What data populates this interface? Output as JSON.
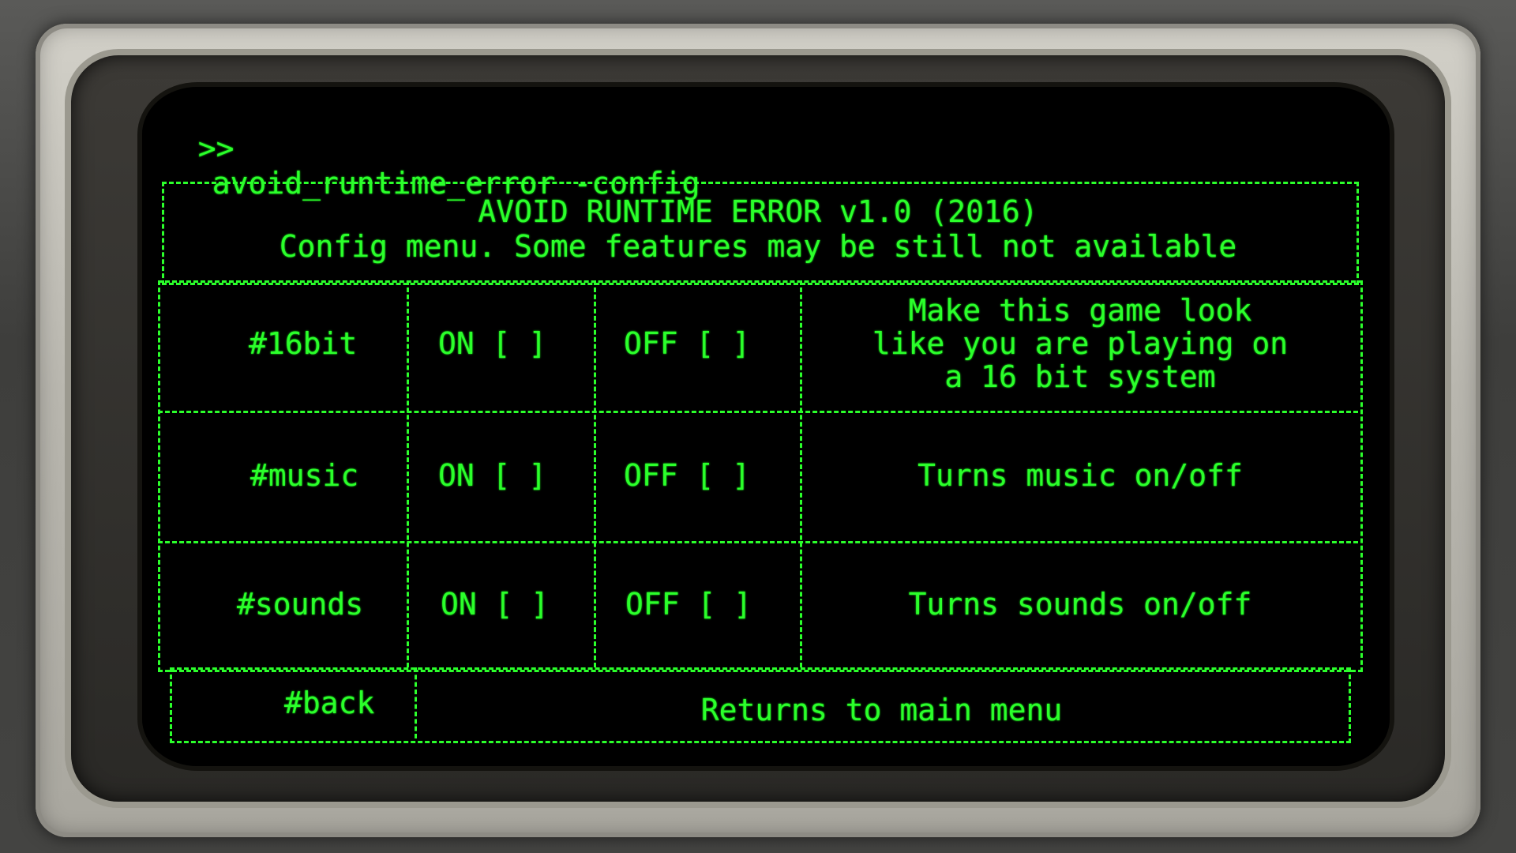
{
  "prompt": {
    "symbol": ">>",
    "command": "avoid_runtime_error -config"
  },
  "header": {
    "title": "AVOID RUNTIME ERROR v1.0 (2016)",
    "subtitle": "Config menu. Some features may be still not available"
  },
  "options": [
    {
      "tag": "#16bit",
      "on_label": "ON [ ]",
      "off_label": "OFF [ ]",
      "description": [
        "Make this game look",
        "like you are playing on",
        "a 16 bit system"
      ]
    },
    {
      "tag": "#music",
      "on_label": "ON [ ]",
      "off_label": "OFF [ ]",
      "description": [
        "Turns music on/off"
      ]
    },
    {
      "tag": "#sounds",
      "on_label": "ON [ ]",
      "off_label": "OFF [ ]",
      "description": [
        "Turns sounds on/off"
      ]
    }
  ],
  "back": {
    "tag": "#back",
    "description": "Returns to main menu"
  },
  "colors": {
    "terminal_green": "#2bff2b",
    "screen_bg": "#000000",
    "bezel": "#b9b7af"
  }
}
